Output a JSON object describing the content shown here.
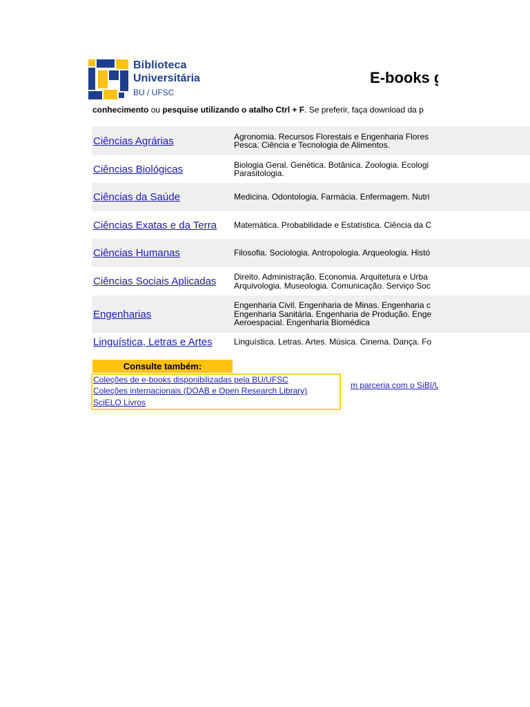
{
  "logo": {
    "line1": "Biblioteca",
    "line2": "Universitária",
    "line3": "BU / UFSC",
    "icon": "library-logo-icon",
    "colors": {
      "blue": "#1f3f8c",
      "yellow": "#ffc20e"
    }
  },
  "title": "E-books g",
  "intro": {
    "b1": "conhecimento",
    "t1": " ou ",
    "b2": "pesquise utilizando o atalho Ctrl + F",
    "t2": ". Se preferir, faça download da p"
  },
  "areas": [
    {
      "name": "Ciências Agrárias",
      "desc": "Agronomia. Recursos Florestais e Engenharia Flores\nPesca. Ciência e Tecnologia de Alimentos."
    },
    {
      "name": "Ciências Biológicas",
      "desc": "Biologia Geral. Genética. Botânica. Zoologia. Ecologi\nParasitologia."
    },
    {
      "name": "Ciências da Saúde",
      "desc": "Medicina. Odontologia. Farmácia. Enfermagem. Nutri"
    },
    {
      "name": "Ciências Exatas e da Terra",
      "desc": "Matemática. Probabilidade e Estatística. Ciência da C"
    },
    {
      "name": "Ciências Humanas",
      "desc": "Filosofia. Sociologia. Antropologia. Arqueologia. Histó"
    },
    {
      "name": "Ciências Sociais Aplicadas",
      "desc": "Direito. Administração. Economia. Arquitetura e Urba\nArquivologia. Museologia. Comunicação. Serviço Soc"
    },
    {
      "name": "Engenharias",
      "desc": "Engenharia Civil. Engenharia de Minas. Engenharia c\nEngenharia Sanitária. Engenharia de Produção. Enge\nAeroespacial. Engenharia Biomédica"
    },
    {
      "name": "Linguística, Letras e Artes",
      "desc": "Linguística. Letras. Artes. Música. Cinema. Dança. Fo"
    }
  ],
  "consulte": {
    "label": "Consulte também:",
    "links": [
      "Coleções de e-books disponibilizadas pela BU/UFSC",
      "Coleções internacionais (DOAB e Open Research Library)",
      "SciELO Livros"
    ],
    "partner_link": "m parceria com o SiBI/UF"
  }
}
